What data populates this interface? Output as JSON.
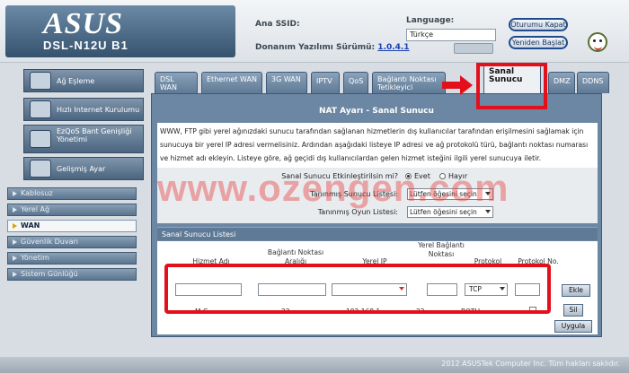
{
  "header": {
    "brand": "ASUS",
    "model": "DSL-N12U B1",
    "ssid_label": "Ana SSID:",
    "firmware_label": "Donanım Yazılımı Sürümü:",
    "firmware_version": "1.0.4.1",
    "language_label": "Language:",
    "language_value": "Türkçe",
    "logout_label": "Oturumu Kapat",
    "reboot_label": "Yeniden Başlat"
  },
  "nav": {
    "items": [
      {
        "label": "Ağ Eşleme"
      },
      {
        "label": "Hızlı Internet Kurulumu"
      },
      {
        "label": "EzQoS Bant Genişliği Yönetimi"
      },
      {
        "label": "Gelişmiş Ayar"
      }
    ],
    "sub_items": [
      {
        "label": "Kablosuz"
      },
      {
        "label": "Yerel Ağ"
      },
      {
        "label": "WAN"
      },
      {
        "label": "Güvenlik Duvarı"
      },
      {
        "label": "Yönetim"
      },
      {
        "label": "Sistem Günlüğü"
      }
    ]
  },
  "tabs": [
    {
      "label": "DSL WAN"
    },
    {
      "label": "Ethernet WAN"
    },
    {
      "label": "3G WAN"
    },
    {
      "label": "IPTV"
    },
    {
      "label": "QoS"
    },
    {
      "label": "Bağlantı Noktası Tetikleyici"
    },
    {
      "label": "Sanal Sunucu"
    },
    {
      "label": "DMZ"
    },
    {
      "label": "DDNS"
    }
  ],
  "panel": {
    "title": "NAT Ayarı - Sanal Sunucu",
    "description": "WWW, FTP gibi yerel ağınızdaki sunucu tarafından sağlanan hizmetlerin dış kullanıcılar tarafından erişilmesini sağlamak için sunucuya bir yerel IP adresi vermelisiniz. Ardından aşağıdaki listeye IP adresi ve ağ protokolü türü, bağlantı noktası numarası ve hizmet adı ekleyin. Listeye göre, ağ geçidi dış kullanıcılardan gelen hizmet isteğini ilgili yerel sunucuya iletir.",
    "enable_label": "Sanal Sunucu Etkinleştirilsin mi?",
    "enable_yes": "Evet",
    "enable_no": "Hayır",
    "known_server_label": "Tanınmış Sunucu Listesi:",
    "known_server_value": "Lütfen öğesini seçin",
    "known_game_label": "Tanınmış Oyun Listesi:",
    "known_game_value": "Lütfen öğesini seçin",
    "list_title": "Sanal Sunucu Listesi",
    "columns": {
      "service": "Hizmet Adı",
      "port_range": "Bağlantı Noktası Aralığı",
      "local_ip": "Yerel IP",
      "local_port": "Yerel Bağlantı Noktası",
      "protocol": "Protokol",
      "protocol_no": "Protokol No."
    },
    "protocol_value": "TCP",
    "add_label": "Ekle",
    "delete_label": "Sil",
    "apply_label": "Uygula",
    "row": {
      "service": "M.C",
      "port_range": "22",
      "local_ip": "192.168.1",
      "local_port": "22",
      "protocol": "BOTH"
    }
  },
  "watermark": "www.ozengen.com",
  "footer": {
    "copyright": "2012 ASUSTek Computer Inc. Tüm hakları saklıdır."
  }
}
